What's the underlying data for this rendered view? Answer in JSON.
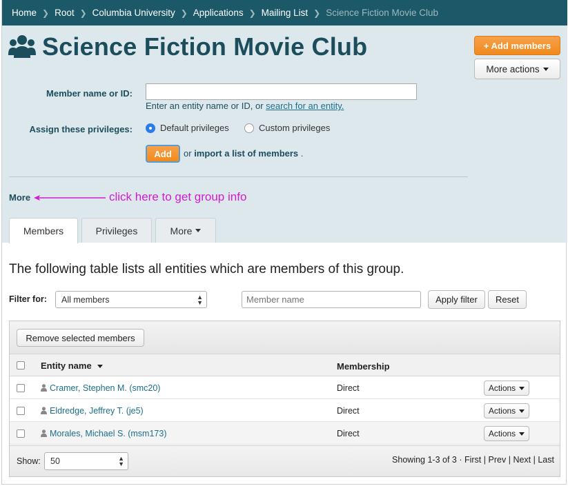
{
  "breadcrumb": {
    "items": [
      "Home",
      "Root",
      "Columbia University",
      "Applications",
      "Mailing List"
    ],
    "current": "Science Fiction Movie Club"
  },
  "group": {
    "title": "Science Fiction Movie Club",
    "icon": "users-group-icon"
  },
  "header_actions": {
    "add_members": "+ Add members",
    "more_actions": "More actions"
  },
  "add_form": {
    "member_label": "Member name or ID:",
    "member_value": "",
    "help_prefix": "Enter an entity name or ID, or ",
    "help_link": "search for an entity.",
    "privileges_label": "Assign these privileges:",
    "option_default": "Default privileges",
    "option_custom": "Custom privileges",
    "selected_option": "default",
    "add_button": "Add",
    "or_text": "or",
    "import_link": "import a list of members",
    "import_suffix": "."
  },
  "more_link": "More",
  "annotation": "click here to get group info",
  "tabs": [
    {
      "label": "Members",
      "active": true
    },
    {
      "label": "Privileges",
      "active": false
    },
    {
      "label": "More",
      "active": false
    }
  ],
  "members_intro": "The following table lists all entities which are members of this group.",
  "filter": {
    "label": "Filter for:",
    "selected": "All members",
    "placeholder": "Member name",
    "apply_button": "Apply filter",
    "reset_button": "Reset"
  },
  "table": {
    "remove_button": "Remove selected members",
    "columns": {
      "entity": "Entity name",
      "membership": "Membership"
    },
    "rows": [
      {
        "name": "Cramer, Stephen M. (smc20)",
        "membership": "Direct",
        "action": "Actions"
      },
      {
        "name": "Eldredge, Jeffrey T. (je5)",
        "membership": "Direct",
        "action": "Actions"
      },
      {
        "name": "Morales, Michael S. (msm173)",
        "membership": "Direct",
        "action": "Actions"
      }
    ],
    "show_label": "Show:",
    "page_size": "50",
    "showing": "Showing 1-3 of 3 ·",
    "paging": {
      "first": "First",
      "prev": "Prev",
      "next": "Next",
      "last": "Last",
      "sep": "|"
    }
  },
  "colors": {
    "breadcrumb_bg": "#1c5968",
    "header_bg": "#dde8ec",
    "title": "#1c4d5c",
    "accent_orange": "#f08a1d",
    "link": "#1c6f8a",
    "annotation": "#d21ad2"
  }
}
